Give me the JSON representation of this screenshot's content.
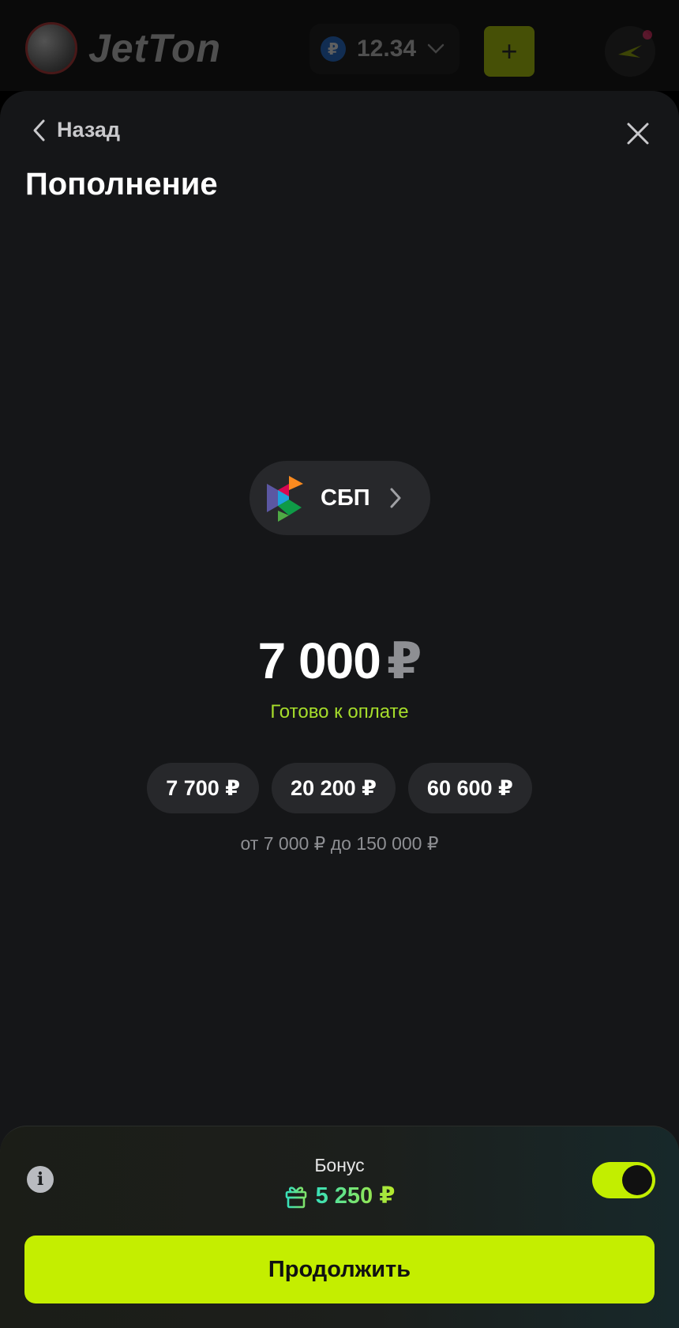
{
  "header": {
    "logo_text": "JetTon",
    "balance": {
      "currency_symbol": "₽",
      "amount": "12.34"
    },
    "plus_label": "+",
    "accent_color": "#b7d300"
  },
  "sheet": {
    "back_label": "Назад",
    "title": "Пополнение",
    "method": {
      "label": "СБП",
      "icon": "sbp-logo-icon"
    },
    "amount": {
      "value": "7 000",
      "currency": "₽"
    },
    "status": "Готово к оплате",
    "quick_amounts": [
      "7 700 ₽",
      "20 200 ₽",
      "60 600 ₽"
    ],
    "range_text": "от 7 000 ₽ до 150 000 ₽"
  },
  "bonus": {
    "label": "Бонус",
    "amount": "5 250 ₽",
    "enabled": true,
    "info_icon": "info-icon",
    "gift_icon": "gift-icon"
  },
  "continue_label": "Продолжить",
  "colors": {
    "background": "#151618",
    "pill": "#27282b",
    "accent_green": "#c4ee00",
    "status_green": "#a6dd2b"
  }
}
